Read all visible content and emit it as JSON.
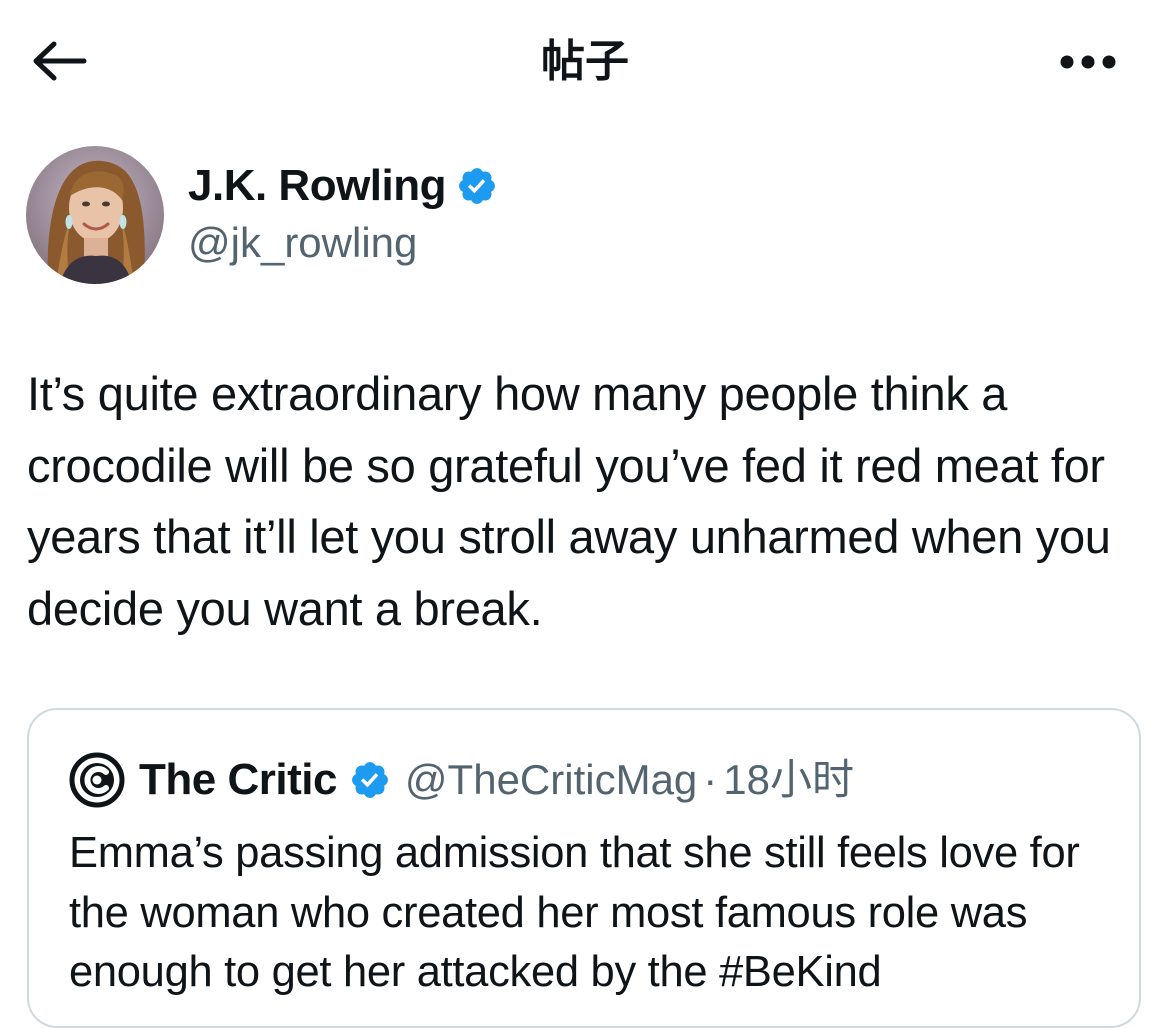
{
  "header": {
    "title": "帖子",
    "back_icon": "arrow-left-icon",
    "more_icon": "more-horizontal-icon"
  },
  "tweet": {
    "author": {
      "name": "J.K. Rowling",
      "handle": "@jk_rowling",
      "verified": true,
      "verified_color": "#1d9bf0"
    },
    "text": "It’s quite extraordinary how many people think a crocodile will be so grateful you’ve fed it red meat for years that it’ll let you stroll away unharmed when you decide you want a break."
  },
  "quote": {
    "name": "The Critic",
    "handle": "@TheCriticMag",
    "separator": "·",
    "time": "18小时",
    "verified": true,
    "text": "Emma’s passing admission that she still feels love for the woman who created her most famous role was enough to get her attacked by the #BeKind"
  },
  "colors": {
    "text_primary": "#0f1419",
    "text_secondary": "#536471",
    "border": "#cfd9de",
    "accent": "#1d9bf0"
  }
}
